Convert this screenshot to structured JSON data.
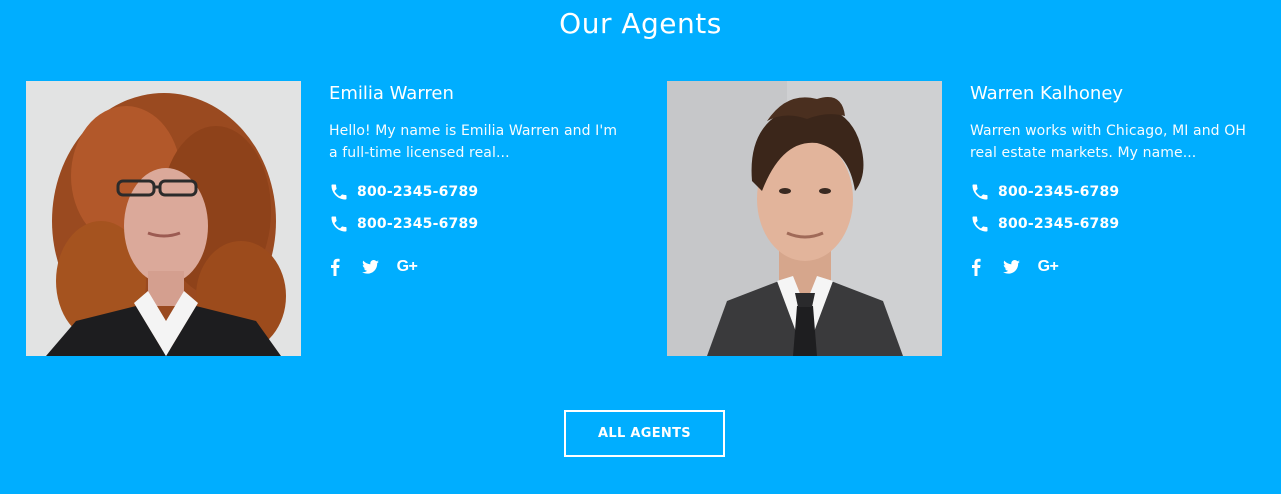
{
  "section": {
    "title": "Our Agents"
  },
  "agents": [
    {
      "name": "Emilia Warren",
      "bio": "Hello! My name is Emilia Warren and I'm a full-time licensed real...",
      "phones": [
        "800-2345-6789",
        "800-2345-6789"
      ],
      "photo_icon": "agent-photo-woman",
      "social_icons": [
        "facebook-icon",
        "twitter-icon",
        "google-plus-icon"
      ]
    },
    {
      "name": "Warren Kalhoney",
      "bio": "Warren works with Chicago, MI and OH real estate markets. My name...",
      "phones": [
        "800-2345-6789",
        "800-2345-6789"
      ],
      "photo_icon": "agent-photo-man",
      "social_icons": [
        "facebook-icon",
        "twitter-icon",
        "google-plus-icon"
      ]
    }
  ],
  "social_labels": {
    "google_plus": "G+"
  },
  "cta": {
    "label": "ALL AGENTS"
  },
  "colors": {
    "background": "#00aeff",
    "text": "#ffffff"
  }
}
